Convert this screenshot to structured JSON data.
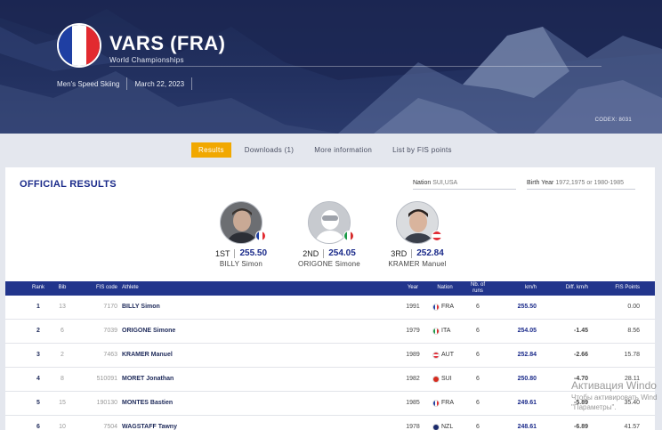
{
  "event": {
    "title": "VARS (FRA)",
    "subtitle": "World Championships",
    "discipline": "Men's Speed Skiing",
    "date": "March 22, 2023",
    "codex": "CODEX: 8031",
    "flag_colors": [
      "#1f3fa3",
      "#ffffff",
      "#e22a2f"
    ]
  },
  "tabs": [
    {
      "label": "Results",
      "active": true
    },
    {
      "label": "Downloads (1)",
      "active": false
    },
    {
      "label": "More information",
      "active": false
    },
    {
      "label": "List by FIS points",
      "active": false
    }
  ],
  "results": {
    "title": "OFFICIAL RESULTS",
    "filters": {
      "nation_label": "Nation",
      "nation_value": "SUI,USA",
      "birth_label": "Birth Year",
      "birth_value": "1972,1975 or 1980-1985"
    }
  },
  "podium": [
    {
      "place": "1ST",
      "points": "255.50",
      "name": "BILLY Simon",
      "nation": "FRA"
    },
    {
      "place": "2ND",
      "points": "254.05",
      "name": "ORIGONE Simone",
      "nation": "ITA"
    },
    {
      "place": "3RD",
      "points": "252.84",
      "name": "KRAMER Manuel",
      "nation": "AUT"
    }
  ],
  "table": {
    "headers": {
      "rank": "Rank",
      "bib": "Bib",
      "fis_code": "FIS code",
      "athlete": "Athlete",
      "year": "Year",
      "nation": "Nation",
      "runs_1": "Nb. of",
      "runs_2": "runs",
      "kmh": "km/h",
      "diff": "Diff. km/h",
      "fis_points": "FIS Points"
    },
    "rows": [
      {
        "rank": "1",
        "bib": "13",
        "fis_code": "7170",
        "athlete": "BILLY Simon",
        "year": "1991",
        "nation": "FRA",
        "runs": "6",
        "kmh": "255.50",
        "diff": "",
        "fis_points": "0.00"
      },
      {
        "rank": "2",
        "bib": "6",
        "fis_code": "7039",
        "athlete": "ORIGONE Simone",
        "year": "1979",
        "nation": "ITA",
        "runs": "6",
        "kmh": "254.05",
        "diff": "-1.45",
        "fis_points": "8.56"
      },
      {
        "rank": "3",
        "bib": "2",
        "fis_code": "7463",
        "athlete": "KRAMER Manuel",
        "year": "1989",
        "nation": "AUT",
        "runs": "6",
        "kmh": "252.84",
        "diff": "-2.66",
        "fis_points": "15.78"
      },
      {
        "rank": "4",
        "bib": "8",
        "fis_code": "510091",
        "athlete": "MORET Jonathan",
        "year": "1982",
        "nation": "SUI",
        "runs": "6",
        "kmh": "250.80",
        "diff": "-4.70",
        "fis_points": "28.11"
      },
      {
        "rank": "5",
        "bib": "15",
        "fis_code": "190130",
        "athlete": "MONTES Bastien",
        "year": "1985",
        "nation": "FRA",
        "runs": "6",
        "kmh": "249.61",
        "diff": "-5.89",
        "fis_points": "35.40"
      },
      {
        "rank": "6",
        "bib": "10",
        "fis_code": "7504",
        "athlete": "WAGSTAFF Tawny",
        "year": "1978",
        "nation": "NZL",
        "runs": "6",
        "kmh": "248.61",
        "diff": "-6.89",
        "fis_points": "41.57"
      }
    ]
  },
  "watermark": {
    "line1": "Активация Windo",
    "line2": "Чтобы активировать Wind",
    "line3": "\"Параметры\"."
  }
}
